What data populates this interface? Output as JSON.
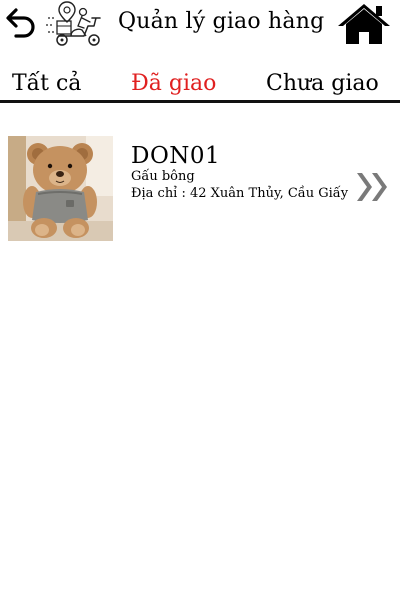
{
  "header": {
    "title": "Quản lý giao hàng",
    "back_icon": "back-arrow-icon",
    "logo_icon": "delivery-scooter-icon",
    "home_icon": "home-icon"
  },
  "tabs": [
    {
      "label": "Tất cả",
      "active": false
    },
    {
      "label": "Đã giao",
      "active": true
    },
    {
      "label": "Chưa giao",
      "active": false
    }
  ],
  "colors": {
    "active_tab": "#e02020",
    "inactive_tab": "#000000",
    "divider": "#111111",
    "chevron": "#7a7a7a"
  },
  "orders": [
    {
      "code": "DON01",
      "product": "Gấu bông",
      "address": "Địa chỉ : 42 Xuân Thủy, Cầu Giấy",
      "thumbnail_icon": "teddy-bear-image",
      "detail_icon": "double-chevron-right-icon"
    }
  ]
}
